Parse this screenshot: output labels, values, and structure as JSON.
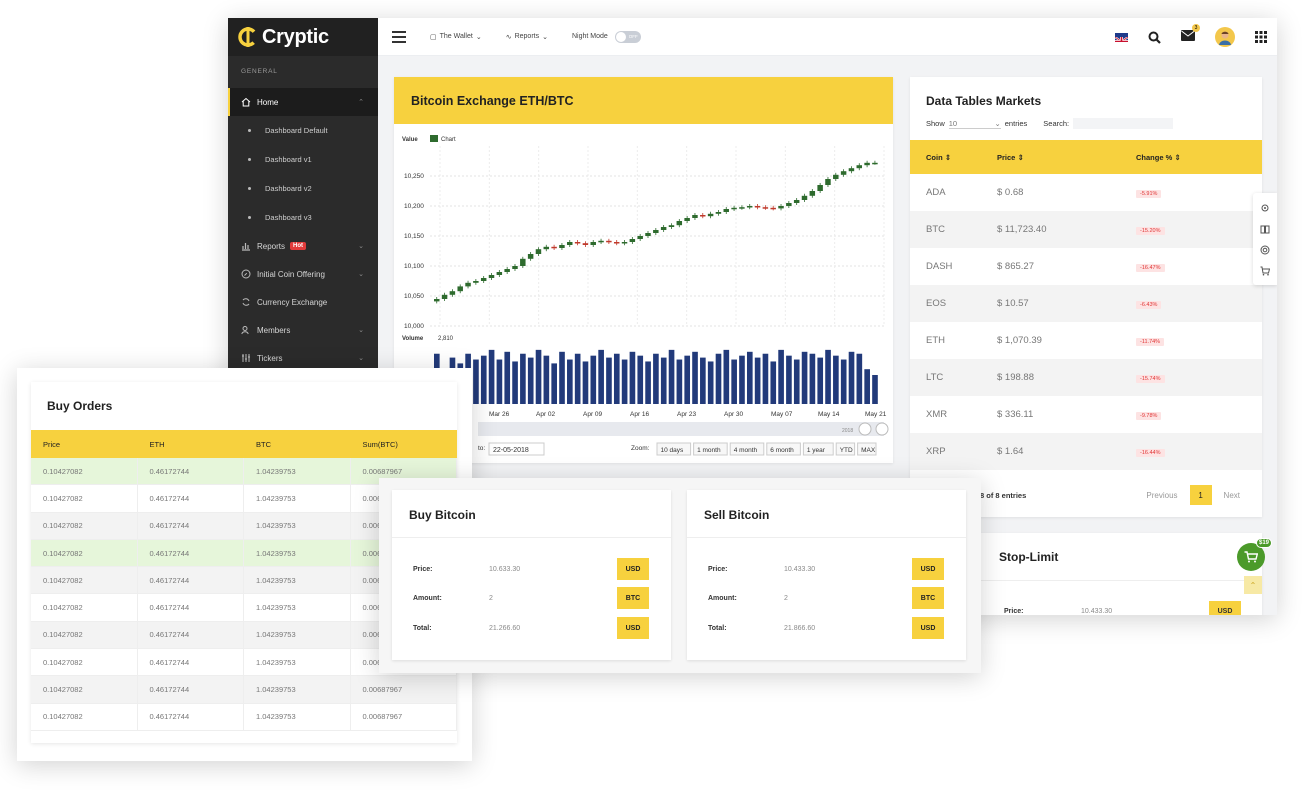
{
  "brand": {
    "name": "Cryptic"
  },
  "sidebar": {
    "section": "GENERAL",
    "home_label": "Home",
    "sub_items": [
      "Dashboard Default",
      "Dashboard v1",
      "Dashboard v2",
      "Dashboard v3"
    ],
    "items": [
      {
        "label": "Reports",
        "badge": "Hot",
        "icon": "bar-chart-icon"
      },
      {
        "label": "Initial Coin Offering",
        "icon": "compass-icon"
      },
      {
        "label": "Currency Exchange",
        "icon": "refresh-icon"
      },
      {
        "label": "Members",
        "icon": "users-icon"
      },
      {
        "label": "Tickers",
        "icon": "sliders-icon"
      }
    ]
  },
  "topbar": {
    "wallet": "The Wallet",
    "reports": "Reports",
    "night_mode": "Night Mode",
    "toggle_state": "OFF",
    "mail_count": "3"
  },
  "chart_card": {
    "title": "Bitcoin Exchange ETH/BTC",
    "value_label": "Value",
    "legend": "Chart",
    "volume_label": "Volume",
    "volume_max": "2,810",
    "to_label": "to:",
    "to_date": "22-05-2018",
    "zoom_label": "Zoom:",
    "zoom_options": [
      "10 days",
      "1 month",
      "4 month",
      "6 month",
      "1 year",
      "YTD",
      "MAX"
    ],
    "nav_year": "2018"
  },
  "chart_data": {
    "type": "candlestick",
    "title": "",
    "ylabel": "Value",
    "ylim": [
      10000,
      10300
    ],
    "yticks": [
      10000,
      10050,
      10100,
      10150,
      10200,
      10250
    ],
    "xticks": [
      "Mar 26",
      "Apr 02",
      "Apr 09",
      "Apr 16",
      "Apr 23",
      "Apr 30",
      "May 07",
      "May 14",
      "May 21"
    ],
    "close": [
      10045,
      10052,
      10058,
      10066,
      10072,
      10075,
      10080,
      10085,
      10090,
      10095,
      10100,
      10112,
      10120,
      10128,
      10132,
      10130,
      10135,
      10140,
      10138,
      10135,
      10140,
      10142,
      10140,
      10138,
      10140,
      10145,
      10150,
      10155,
      10160,
      10165,
      10168,
      10175,
      10180,
      10185,
      10183,
      10187,
      10190,
      10195,
      10197,
      10198,
      10200,
      10198,
      10197,
      10196,
      10200,
      10205,
      10210,
      10217,
      10225,
      10235,
      10245,
      10252,
      10258,
      10263,
      10268,
      10272,
      10272
    ],
    "volume_ylim": [
      0,
      3000
    ],
    "volume": [
      2600,
      1800,
      2400,
      2100,
      2600,
      2300,
      2500,
      2800,
      2300,
      2700,
      2200,
      2600,
      2400,
      2800,
      2500,
      2100,
      2700,
      2300,
      2600,
      2200,
      2500,
      2800,
      2400,
      2600,
      2300,
      2700,
      2500,
      2200,
      2600,
      2400,
      2800,
      2300,
      2500,
      2700,
      2400,
      2200,
      2600,
      2800,
      2300,
      2500,
      2700,
      2400,
      2600,
      2200,
      2800,
      2500,
      2300,
      2700,
      2600,
      2400,
      2800,
      2500,
      2300,
      2700,
      2600,
      1800,
      1500
    ],
    "up_color": "#2e6b2e",
    "down_color": "#c0392b",
    "volume_color": "#223a7a"
  },
  "markets": {
    "title": "Data Tables Markets",
    "show_label": "Show",
    "show_value": "10",
    "entries_label": "entries",
    "search_label": "Search:",
    "headers": [
      "Coin",
      "Price",
      "Change %"
    ],
    "rows": [
      {
        "coin": "ADA",
        "price": "$ 0.68",
        "change": "-5.91%"
      },
      {
        "coin": "BTC",
        "price": "$ 11,723.40",
        "change": "-15.20%"
      },
      {
        "coin": "DASH",
        "price": "$ 865.27",
        "change": "-16.47%"
      },
      {
        "coin": "EOS",
        "price": "$ 10.57",
        "change": "-6.43%"
      },
      {
        "coin": "ETH",
        "price": "$ 1,070.39",
        "change": "-11.74%"
      },
      {
        "coin": "LTC",
        "price": "$ 198.88",
        "change": "-15.74%"
      },
      {
        "coin": "XMR",
        "price": "$ 336.11",
        "change": "-9.78%"
      },
      {
        "coin": "XRP",
        "price": "$ 1.64",
        "change": "-16.44%"
      }
    ],
    "footer_info": "8 of 8 entries",
    "previous": "Previous",
    "page": "1",
    "next": "Next"
  },
  "stop_limit": {
    "title": "Stop-Limit",
    "price_label": "Price:",
    "price_value": "10.433.30",
    "currency": "USD"
  },
  "cart": {
    "badge": "$19"
  },
  "buy_orders": {
    "title": "Buy Orders",
    "headers": [
      "Price",
      "ETH",
      "BTC",
      "Sum(BTC)"
    ],
    "rows": [
      {
        "price": "0.10427082",
        "eth": "0.46172744",
        "btc": "1.04239753",
        "sum": "0.00687967",
        "style": "green"
      },
      {
        "price": "0.10427082",
        "eth": "0.46172744",
        "btc": "1.04239753",
        "sum": "0.006",
        "style": "white"
      },
      {
        "price": "0.10427082",
        "eth": "0.46172744",
        "btc": "1.04239753",
        "sum": "0.006",
        "style": "grey"
      },
      {
        "price": "0.10427082",
        "eth": "0.46172744",
        "btc": "1.04239753",
        "sum": "0.006",
        "style": "green"
      },
      {
        "price": "0.10427082",
        "eth": "0.46172744",
        "btc": "1.04239753",
        "sum": "0.006",
        "style": "grey"
      },
      {
        "price": "0.10427082",
        "eth": "0.46172744",
        "btc": "1.04239753",
        "sum": "0.006",
        "style": "white"
      },
      {
        "price": "0.10427082",
        "eth": "0.46172744",
        "btc": "1.04239753",
        "sum": "0.006",
        "style": "grey"
      },
      {
        "price": "0.10427082",
        "eth": "0.46172744",
        "btc": "1.04239753",
        "sum": "0.006",
        "style": "white"
      },
      {
        "price": "0.10427082",
        "eth": "0.46172744",
        "btc": "1.04239753",
        "sum": "0.00687967",
        "style": "grey"
      },
      {
        "price": "0.10427082",
        "eth": "0.46172744",
        "btc": "1.04239753",
        "sum": "0.00687967",
        "style": "white"
      }
    ]
  },
  "buy_bitcoin": {
    "title": "Buy Bitcoin",
    "rows": [
      {
        "label": "Price:",
        "value": "10.633.30",
        "unit": "USD"
      },
      {
        "label": "Amount:",
        "value": "2",
        "unit": "BTC"
      },
      {
        "label": "Total:",
        "value": "21.266.60",
        "unit": "USD"
      }
    ]
  },
  "sell_bitcoin": {
    "title": "Sell Bitcoin",
    "rows": [
      {
        "label": "Price:",
        "value": "10.433.30",
        "unit": "USD"
      },
      {
        "label": "Amount:",
        "value": "2",
        "unit": "BTC"
      },
      {
        "label": "Total:",
        "value": "21.866.60",
        "unit": "USD"
      }
    ]
  },
  "colors": {
    "accent": "#f7d13e",
    "sidebar": "#2b2b2b",
    "positive": "#2e6b2e",
    "negative": "#e03434"
  }
}
